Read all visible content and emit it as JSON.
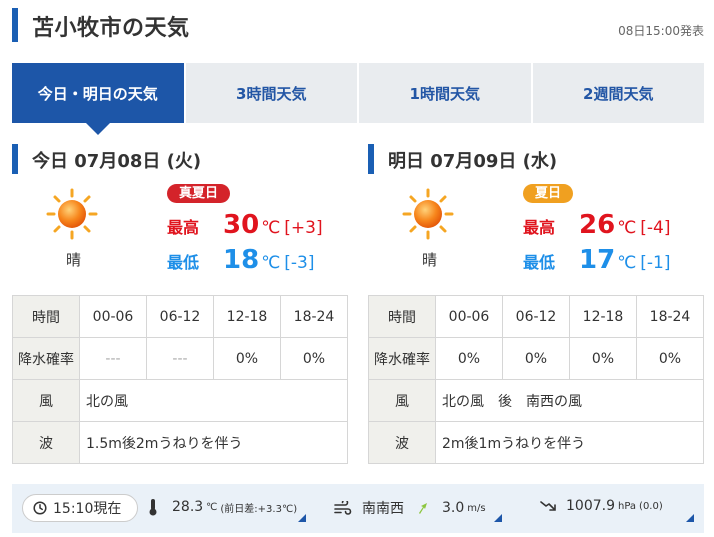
{
  "header": {
    "title": "苫小牧市の天気",
    "issued": "08日15:00発表"
  },
  "tabs": [
    {
      "label": "今日・明日の天気",
      "active": true
    },
    {
      "label": "3時間天気",
      "active": false
    },
    {
      "label": "1時間天気",
      "active": false
    },
    {
      "label": "2週間天気",
      "active": false
    }
  ],
  "today": {
    "title": "今日 07月08日 (火)",
    "weather": "晴",
    "icon": "sun-icon",
    "badge": "真夏日",
    "badge_color": "#d4232a",
    "high_label": "最高",
    "high": "30",
    "high_unit": "℃",
    "high_diff": "[+3]",
    "low_label": "最低",
    "low": "18",
    "low_unit": "℃",
    "low_diff": "[-3]",
    "table": {
      "time_label": "時間",
      "periods": [
        "00-06",
        "06-12",
        "12-18",
        "18-24"
      ],
      "rain_label": "降水確率",
      "rain": [
        "---",
        "---",
        "0%",
        "0%"
      ],
      "wind_label": "風",
      "wind": "北の風",
      "wave_label": "波",
      "wave": "1.5m後2mうねりを伴う"
    }
  },
  "tomorrow": {
    "title": "明日 07月09日 (水)",
    "weather": "晴",
    "icon": "sun-icon",
    "badge": "夏日",
    "badge_color": "#f0a020",
    "high_label": "最高",
    "high": "26",
    "high_unit": "℃",
    "high_diff": "[-4]",
    "low_label": "最低",
    "low": "17",
    "low_unit": "℃",
    "low_diff": "[-1]",
    "table": {
      "time_label": "時間",
      "periods": [
        "00-06",
        "06-12",
        "12-18",
        "18-24"
      ],
      "rain_label": "降水確率",
      "rain": [
        "0%",
        "0%",
        "0%",
        "0%"
      ],
      "wind_label": "風",
      "wind": "北の風　後　南西の風",
      "wave_label": "波",
      "wave": "2m後1mうねりを伴う"
    }
  },
  "observation": {
    "time": "15:10現在",
    "temp": "28.3",
    "temp_unit": "℃",
    "temp_diff": "(前日差:+3.3℃)",
    "wind_dir": "南南西",
    "wind_speed": "3.0",
    "wind_unit": "m/s",
    "pressure": "1007.9",
    "pressure_unit": "hPa",
    "pressure_diff": "(0.0)"
  },
  "colors": {
    "accent": "#1d56a8",
    "high": "#e0141e",
    "low": "#1e8fe8"
  }
}
